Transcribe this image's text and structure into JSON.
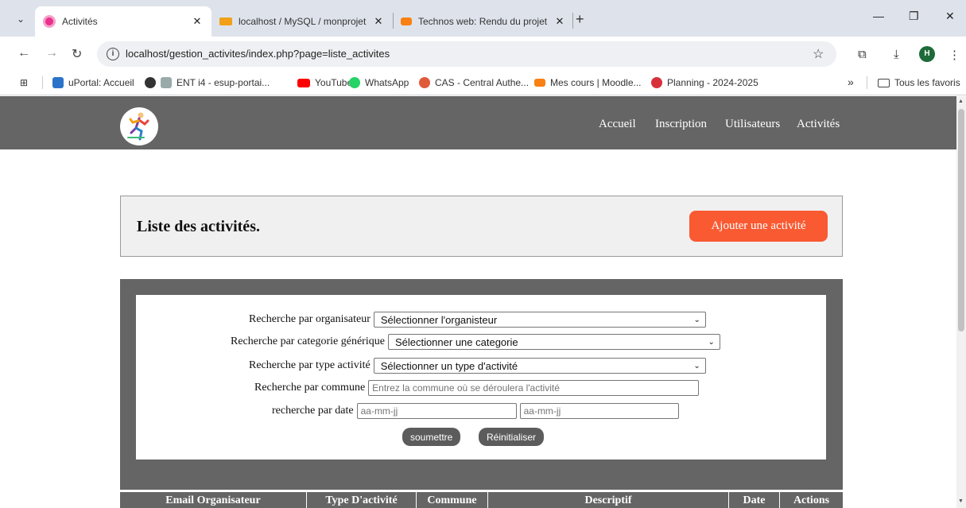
{
  "browser": {
    "tabs": [
      {
        "title": "Activités",
        "active": true
      },
      {
        "title": "localhost / MySQL / monprojet",
        "active": false
      },
      {
        "title": "Technos web: Rendu du projet",
        "active": false
      }
    ],
    "url": "localhost/gestion_activites/index.php?page=liste_activites",
    "profile_initial": "H",
    "bookmarks": [
      "uPortal: Accueil",
      "ENT i4 - esup-portai...",
      "YouTube",
      "WhatsApp",
      "CAS - Central Authe...",
      "Mes cours | Moodle...",
      "Planning - 2024-2025"
    ],
    "bookmarks_overflow": "»",
    "all_bookmarks": "Tous les favoris"
  },
  "site": {
    "nav": [
      "Accueil",
      "Inscription",
      "Utilisateurs",
      "Activités"
    ],
    "page_title": "Liste des activités.",
    "add_button": "Ajouter une activité"
  },
  "search": {
    "organisateur": {
      "label": "Recherche par organisateur",
      "value": "Sélectionner l'organisteur"
    },
    "categorie": {
      "label": "Recherche par categorie générique",
      "value": "Sélectionner une categorie"
    },
    "type": {
      "label": "Recherche par type activité",
      "value": "Sélectionner un type d'activité"
    },
    "commune": {
      "label": "Recherche par commune",
      "placeholder": "Entrez la commune où se déroulera l'activité"
    },
    "date": {
      "label": "recherche par date",
      "from_placeholder": "aa-mm-jj",
      "to_placeholder": "aa-mm-jj"
    },
    "submit": "soumettre",
    "reset": "Réinitialiser"
  },
  "table": {
    "headers": [
      "Email Organisateur",
      "Type D'activité",
      "Commune",
      "Descriptif",
      "Date",
      "Actions"
    ]
  },
  "colors": {
    "header_bg": "#656565",
    "accent_button": "#fa5a32"
  }
}
